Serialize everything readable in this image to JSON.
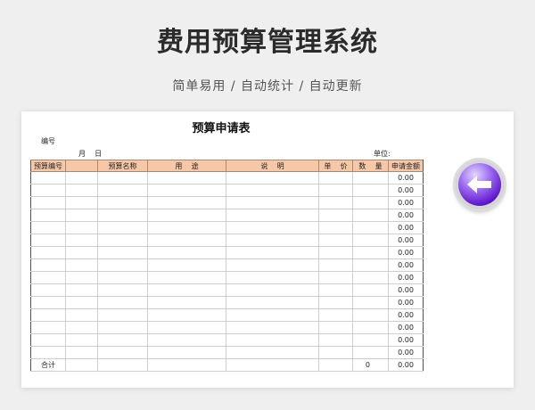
{
  "banner": {
    "title": "费用预算管理系统",
    "subtitle": "简单易用  /  自动统计  /  自动更新"
  },
  "form": {
    "title": "预算申请表",
    "code_label": "编号",
    "date_label": "月    日",
    "unit_label": "单位:",
    "columns": [
      "预算编号",
      "",
      "预算名称",
      "用    途",
      "说    明",
      "单    价",
      "数    量",
      "申请金额"
    ],
    "row_amounts": [
      "0.00",
      "0.00",
      "0.00",
      "0.00",
      "0.00",
      "0.00",
      "0.00",
      "0.00",
      "0.00",
      "0.00",
      "0.00",
      "0.00",
      "0.00",
      "0.00",
      "0.00"
    ],
    "total": {
      "label": "合计",
      "quantity": "0",
      "amount": "0.00"
    }
  },
  "back_button": {
    "icon": "arrow-left-icon",
    "color": "#5b12c9"
  }
}
